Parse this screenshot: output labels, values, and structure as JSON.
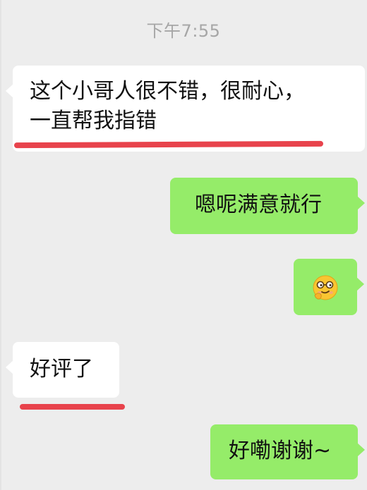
{
  "chat": {
    "timestamp": "下午7:55",
    "messages": [
      {
        "sender": "other",
        "line1": "这个小哥人很不错，很耐心，",
        "line2": "一直帮我指错"
      },
      {
        "sender": "me",
        "text": "嗯呢满意就行"
      },
      {
        "sender": "me",
        "icon": "smirk-glasses-emoji-icon"
      },
      {
        "sender": "other",
        "text": "好评了"
      },
      {
        "sender": "me",
        "text": "好嘞谢谢~"
      }
    ]
  },
  "colors": {
    "background": "#ededed",
    "incoming_bubble": "#ffffff",
    "outgoing_bubble": "#95ec69",
    "timestamp_text": "#a6a6a6",
    "highlight_underline": "#e8434c",
    "emoji_face": "#f9c531"
  }
}
